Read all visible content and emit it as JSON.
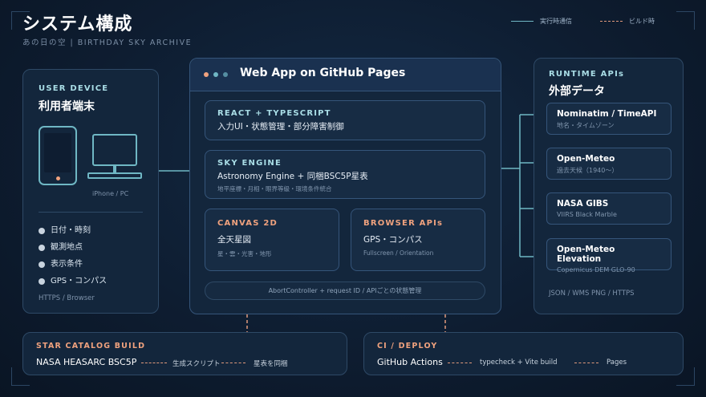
{
  "header": {
    "title": "システム構成",
    "subtitle": "あの日の空 | BIRTHDAY SKY ARCHIVE"
  },
  "legend": {
    "runtime": "実行時通信",
    "build": "ビルド時"
  },
  "colors": {
    "runtime_line": "#6fb7c4",
    "build_line": "#e09a7c",
    "accent_orange": "#f0a27e",
    "accent_cyan": "#a9dde6"
  },
  "user_device": {
    "label": "USER DEVICE",
    "title": "利用者端末",
    "device_caption": "iPhone / PC",
    "items": [
      "日付・時刻",
      "観測地点",
      "表示条件",
      "GPS・コンパス"
    ],
    "footer": "HTTPS / Browser"
  },
  "web_app": {
    "title": "Web App on GitHub Pages",
    "react": {
      "label": "REACT + TYPESCRIPT",
      "desc": "入力UI・状態管理・部分障害制御"
    },
    "sky": {
      "label": "SKY ENGINE",
      "desc": "Astronomy Engine + 同梱BSC5P星表",
      "sub": "地平座標・月相・眼界等級・環境条件統合"
    },
    "canvas": {
      "label": "CANVAS 2D",
      "desc": "全天星図",
      "sub": "星・雲・光害・地形"
    },
    "browser": {
      "label": "BROWSER APIs",
      "desc": "GPS・コンパス",
      "sub": "Fullscreen / Orientation"
    },
    "footer": "AbortController + request ID / APIごとの状態管理"
  },
  "runtime_apis": {
    "label": "RUNTIME APIs",
    "title": "外部データ",
    "items": [
      {
        "name": "Nominatim / TimeAPI",
        "desc": "地名・タイムゾーン"
      },
      {
        "name": "Open-Meteo",
        "desc": "過去天候（1940〜）"
      },
      {
        "name": "NASA GIBS",
        "desc": "VIIRS Black Marble"
      },
      {
        "name": "Open-Meteo Elevation",
        "desc": "Copernicus DEM GLO-90"
      }
    ],
    "footer": "JSON / WMS PNG / HTTPS"
  },
  "star_catalog": {
    "label": "STAR CATALOG BUILD",
    "source": "NASA HEASARC BSC5P",
    "step1": "生成スクリプト",
    "step2": "星表を同梱"
  },
  "ci_deploy": {
    "label": "CI / DEPLOY",
    "source": "GitHub Actions",
    "step1": "typecheck + Vite build",
    "step2": "Pages"
  }
}
